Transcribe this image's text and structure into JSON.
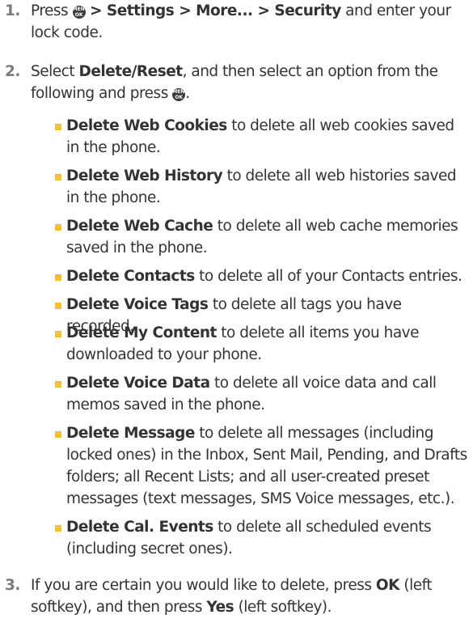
{
  "steps": [
    {
      "number": "1.",
      "parts": [
        "Press",
        "> Settings > More... > Security",
        "and enter your lock code."
      ]
    },
    {
      "number": "2.",
      "parts": [
        "Select",
        "Delete/Reset",
        ", and then select an option from the following and press",
        "."
      ]
    },
    {
      "number": "3.",
      "parts": [
        "If you are certain you would like to delete, press",
        "OK",
        "(left softkey), and then press",
        "Yes",
        "(left softkey)."
      ]
    }
  ],
  "menu_key_icon": {
    "name": "menu-ok-key-icon",
    "top": "MENU",
    "bottom": "OK"
  },
  "options": [
    {
      "term": "Delete Web Cookies",
      "desc": "to delete all web cookies saved in the phone."
    },
    {
      "term": "Delete Web History",
      "desc": "to delete all web histories saved in the phone."
    },
    {
      "term": "Delete Web Cache",
      "desc": "to delete all web cache memories saved in the phone."
    },
    {
      "term": "Delete Contacts",
      "desc": "to delete all of your Contacts entries."
    },
    {
      "term": "Delete Voice Tags",
      "desc": "to delete all tags you have recorded."
    },
    {
      "term": "Delete My Content",
      "desc": "to delete all items you have downloaded to your phone."
    },
    {
      "term": "Delete Voice Data",
      "desc": "to delete all voice data and call memos saved in the phone."
    },
    {
      "term": "Delete Message",
      "desc": "to delete all messages (including locked ones) in the Inbox, Sent Mail, Pending, and Drafts folders; all Recent Lists; and all user-created preset messages (text messages, SMS Voice messages, etc.)."
    },
    {
      "term": "Delete Cal. Events",
      "desc": "to delete all scheduled events (including secret ones)."
    }
  ],
  "colors": {
    "text": "#333333",
    "number": "#7a7a7a",
    "bullet": "#f5c033",
    "key": "#3a3a3a"
  }
}
